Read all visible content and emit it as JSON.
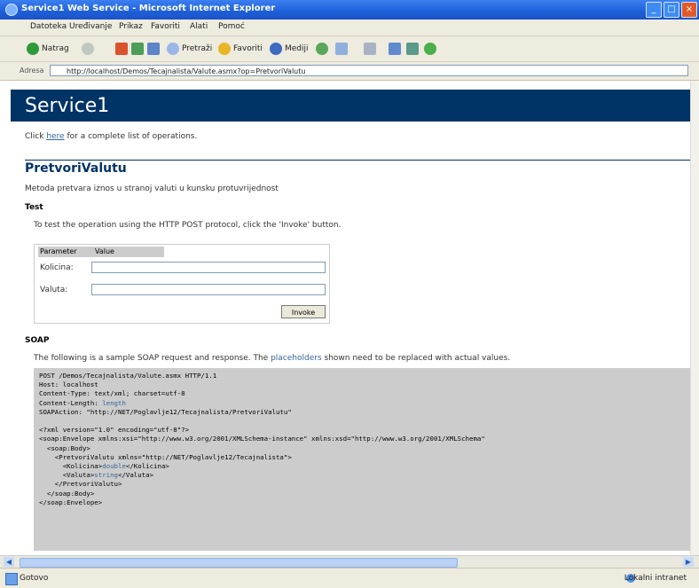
{
  "window": {
    "title": "Service1 Web Service - Microsoft Internet Explorer",
    "buttons": [
      "_",
      "□",
      "×"
    ]
  },
  "menu": {
    "items": [
      "Datoteka",
      "Uređivanje",
      "Prikaz",
      "Favoriti",
      "Alati",
      "Pomoć"
    ]
  },
  "toolbar": {
    "back": "Natrag",
    "search": "Pretraži",
    "favorites": "Favoriti",
    "media": "Mediji"
  },
  "address": {
    "label": "Adresa",
    "url": "http://localhost/Demos/Tecajnalista/Valute.asmx?op=PretvoriValutu"
  },
  "page": {
    "service_name": "Service1",
    "intro_prefix": "Click ",
    "intro_link": "here",
    "intro_suffix": " for a complete list of operations.",
    "operation_title": "PretvoriValutu",
    "operation_desc": "Metoda pretvara iznos u stranoj valuti u kunsku protuvrijednost",
    "test_heading": "Test",
    "test_note": "To test the operation using the HTTP POST protocol, click the 'Invoke' button.",
    "form": {
      "col_parameter": "Parameter",
      "col_value": "Value",
      "param1": "Kolicina:",
      "param2": "Valuta:",
      "invoke_label": "Invoke",
      "param1_value": "",
      "param2_value": ""
    },
    "soap_heading": "SOAP",
    "soap_note_prefix": "The following is a sample SOAP request and response. The ",
    "soap_note_link": "placeholders",
    "soap_note_suffix": " shown need to be replaced with actual values.",
    "code": {
      "l1": "POST /Demos/Tecajnalista/Valute.asmx HTTP/1.1",
      "l2": "Host: localhost",
      "l3": "Content-Type: text/xml; charset=utf-8",
      "l4a": "Content-Length: ",
      "l4b": "length",
      "l5": "SOAPAction: \"http://NET/Poglavlje12/Tecajnalista/PretvoriValutu\"",
      "l6": "<?xml version=\"1.0\" encoding=\"utf-8\"?>",
      "l7": "<soap:Envelope xmlns:xsi=\"http://www.w3.org/2001/XMLSchema-instance\" xmlns:xsd=\"http://www.w3.org/2001/XMLSchema\"",
      "l8": "  <soap:Body>",
      "l9": "    <PretvoriValutu xmlns=\"http://NET/Poglavlje12/Tecajnalista\">",
      "l10a": "      <Kolicina>",
      "l10b": "double",
      "l10c": "</Kolicina>",
      "l11a": "      <Valuta>",
      "l11b": "string",
      "l11c": "</Valuta>",
      "l12": "    </PretvoriValutu>",
      "l13": "  </soap:Body>",
      "l14": "</soap:Envelope>"
    }
  },
  "status": {
    "done": "Gotovo",
    "zone": "Lokalni intranet"
  },
  "colors": {
    "banner": "#003366",
    "link": "#336699",
    "code_bg": "#cccccc"
  }
}
